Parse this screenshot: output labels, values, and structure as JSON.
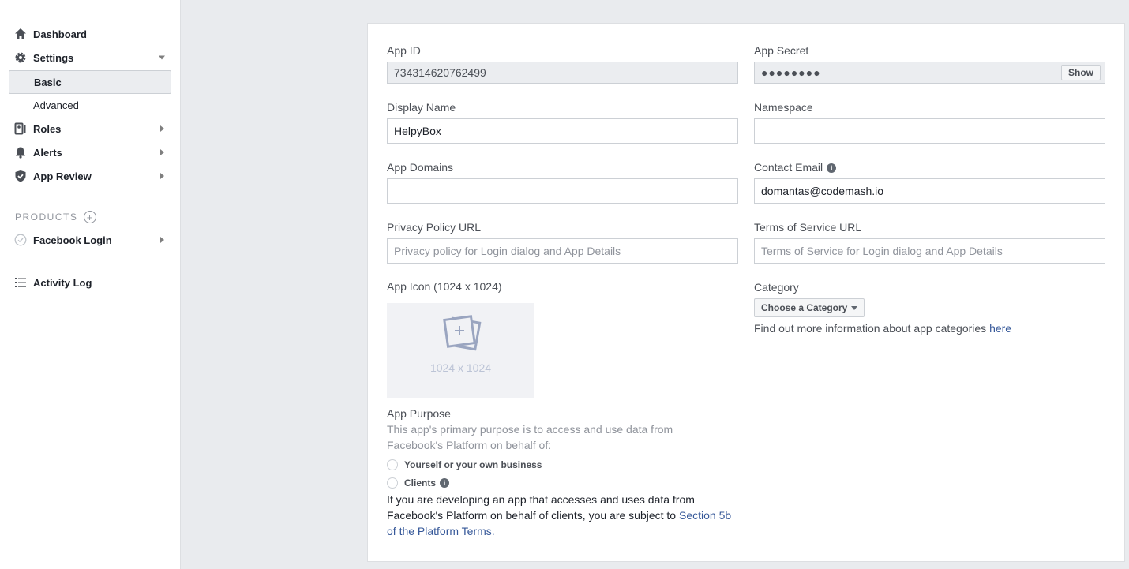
{
  "sidebar": {
    "dashboard": "Dashboard",
    "settings": "Settings",
    "basic": "Basic",
    "advanced": "Advanced",
    "roles": "Roles",
    "alerts": "Alerts",
    "app_review": "App Review",
    "products_header": "PRODUCTS",
    "facebook_login": "Facebook Login",
    "activity_log": "Activity Log"
  },
  "form": {
    "app_id_label": "App ID",
    "app_id_value": "734314620762499",
    "app_secret_label": "App Secret",
    "app_secret_masked": "●●●●●●●●",
    "show_button": "Show",
    "display_name_label": "Display Name",
    "display_name_value": "HelpyBox",
    "namespace_label": "Namespace",
    "namespace_value": "",
    "app_domains_label": "App Domains",
    "app_domains_value": "",
    "contact_email_label": "Contact Email",
    "contact_email_value": "domantas@codemash.io",
    "privacy_label": "Privacy Policy URL",
    "privacy_placeholder": "Privacy policy for Login dialog and App Details",
    "tos_label": "Terms of Service URL",
    "tos_placeholder": "Terms of Service for Login dialog and App Details",
    "app_icon_label": "App Icon (1024 x 1024)",
    "app_icon_dim": "1024 x 1024",
    "category_label": "Category",
    "category_button": "Choose a Category",
    "category_help": "Find out more information about app categories ",
    "category_help_link": "here",
    "purpose_label": "App Purpose",
    "purpose_desc": "This app's primary purpose is to access and use data from Facebook's Platform on behalf of:",
    "option_self": "Yourself or your own business",
    "option_clients": "Clients",
    "disclaimer": "If you are developing an app that accesses and uses data from Facebook's Platform on behalf of clients, you are subject to ",
    "disclaimer_link": "Section 5b of the Platform Terms."
  },
  "colors": {
    "link": "#365899",
    "page_bg": "#e9ebee",
    "readonly_bg": "#ebedf0"
  }
}
